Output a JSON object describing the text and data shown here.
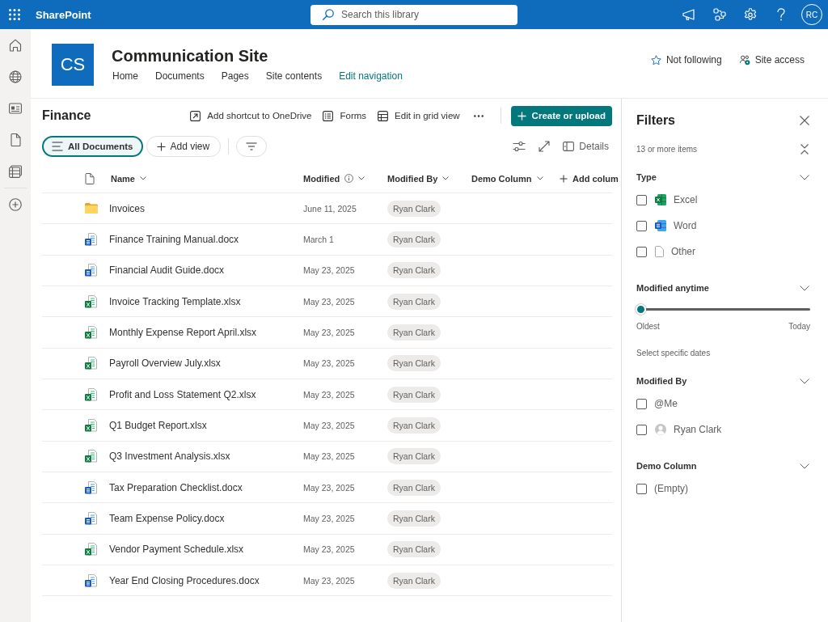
{
  "top_bar": {
    "app_name": "SharePoint",
    "search": {
      "placeholder": "Search this library"
    },
    "avatar_initials": "RC"
  },
  "site_header": {
    "logo_initials": "CS",
    "title": "Communication Site",
    "nav": [
      {
        "label": "Home",
        "kind": "link"
      },
      {
        "label": "Documents",
        "kind": "link"
      },
      {
        "label": "Pages",
        "kind": "link"
      },
      {
        "label": "Site contents",
        "kind": "link"
      },
      {
        "label": "Edit navigation",
        "kind": "edit"
      }
    ],
    "actions": [
      {
        "label": "Not following",
        "kind": "follow"
      },
      {
        "label": "Site access",
        "kind": "access"
      }
    ]
  },
  "library": {
    "title": "Finance",
    "commands": [
      {
        "label": "Add shortcut to OneDrive",
        "kind": "shortcut"
      },
      {
        "label": "Forms",
        "kind": "forms"
      },
      {
        "label": "Edit in grid view",
        "kind": "grid"
      }
    ],
    "primary_button": "Create or upload",
    "views": [
      {
        "label": "All Documents",
        "selected": true
      }
    ],
    "add_view": "Add view",
    "details": "Details",
    "columns": [
      {
        "label": "Name",
        "info": false
      },
      {
        "label": "Modified",
        "info": true
      },
      {
        "label": "Modified By",
        "info": false
      },
      {
        "label": "Demo Column",
        "info": false
      }
    ],
    "add_column": "Add colum",
    "rows": [
      {
        "name": "Invoices",
        "kind": "folder",
        "modified": "June 11, 2025",
        "modified_by": "Ryan Clark"
      },
      {
        "name": "Finance Training Manual.docx",
        "kind": "word",
        "modified": "March 1",
        "modified_by": "Ryan Clark"
      },
      {
        "name": "Financial Audit Guide.docx",
        "kind": "word",
        "modified": "May 23, 2025",
        "modified_by": "Ryan Clark"
      },
      {
        "name": "Invoice Tracking Template.xlsx",
        "kind": "excel",
        "modified": "May 23, 2025",
        "modified_by": "Ryan Clark"
      },
      {
        "name": "Monthly Expense Report April.xlsx",
        "kind": "excel",
        "modified": "May 23, 2025",
        "modified_by": "Ryan Clark"
      },
      {
        "name": "Payroll Overview July.xlsx",
        "kind": "excel",
        "modified": "May 23, 2025",
        "modified_by": "Ryan Clark"
      },
      {
        "name": "Profit and Loss Statement Q2.xlsx",
        "kind": "excel",
        "modified": "May 23, 2025",
        "modified_by": "Ryan Clark"
      },
      {
        "name": "Q1 Budget Report.xlsx",
        "kind": "excel",
        "modified": "May 23, 2025",
        "modified_by": "Ryan Clark"
      },
      {
        "name": "Q3 Investment Analysis.xlsx",
        "kind": "excel",
        "modified": "May 23, 2025",
        "modified_by": "Ryan Clark"
      },
      {
        "name": "Tax Preparation Checklist.docx",
        "kind": "word",
        "modified": "May 23, 2025",
        "modified_by": "Ryan Clark"
      },
      {
        "name": "Team Expense Policy.docx",
        "kind": "word",
        "modified": "May 23, 2025",
        "modified_by": "Ryan Clark"
      },
      {
        "name": "Vendor Payment Schedule.xlsx",
        "kind": "excel",
        "modified": "May 23, 2025",
        "modified_by": "Ryan Clark"
      },
      {
        "name": "Year End Closing Procedures.docx",
        "kind": "word",
        "modified": "May 23, 2025",
        "modified_by": "Ryan Clark"
      }
    ]
  },
  "filters": {
    "title": "Filters",
    "count": "13 or more items",
    "sections": [
      {
        "title": "Type",
        "kind": "checklist",
        "options": [
          {
            "label": "Excel",
            "kind": "excel",
            "checked": false
          },
          {
            "label": "Word",
            "kind": "word",
            "checked": false
          },
          {
            "label": "Other",
            "kind": "other",
            "checked": false
          }
        ]
      },
      {
        "title": "Modified anytime",
        "kind": "range",
        "level": 0,
        "start_label": "Oldest",
        "end_label": "Today",
        "link": "Select specific dates"
      },
      {
        "title": "Modified By",
        "kind": "checklist",
        "options": [
          {
            "label": "@Me",
            "kind": "plain",
            "checked": false
          },
          {
            "label": "Ryan Clark",
            "kind": "person",
            "checked": false
          }
        ]
      },
      {
        "title": "Demo Column",
        "kind": "checklist",
        "options": [
          {
            "label": "(Empty)",
            "kind": "plain",
            "checked": false
          }
        ]
      }
    ]
  }
}
